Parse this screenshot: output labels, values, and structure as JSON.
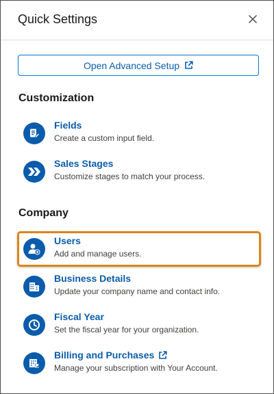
{
  "header": {
    "title": "Quick Settings",
    "close_icon": "close-icon"
  },
  "advanced_setup": {
    "label": "Open Advanced Setup",
    "icon": "external-link-icon"
  },
  "sections": {
    "customization": {
      "title": "Customization",
      "items": [
        {
          "title": "Fields",
          "description": "Create a custom input field.",
          "icon": "fields-icon"
        },
        {
          "title": "Sales Stages",
          "description": "Customize stages to match your process.",
          "icon": "stages-chevron-icon"
        }
      ]
    },
    "company": {
      "title": "Company",
      "items": [
        {
          "title": "Users",
          "description": "Add and manage users.",
          "icon": "user-add-icon",
          "highlighted": true
        },
        {
          "title": "Business Details",
          "description": "Update your company name and contact info.",
          "icon": "building-icon"
        },
        {
          "title": "Fiscal Year",
          "description": "Set the fiscal year for your organization.",
          "icon": "clock-icon"
        },
        {
          "title": "Billing and Purchases",
          "description": "Manage your subscription with Your Account.",
          "icon": "billing-store-icon",
          "external": true
        }
      ]
    }
  },
  "colors": {
    "brand_blue": "#0b5cab",
    "button_border": "#0176d3",
    "highlight_orange": "#d9861b",
    "text_dark": "#181818"
  }
}
